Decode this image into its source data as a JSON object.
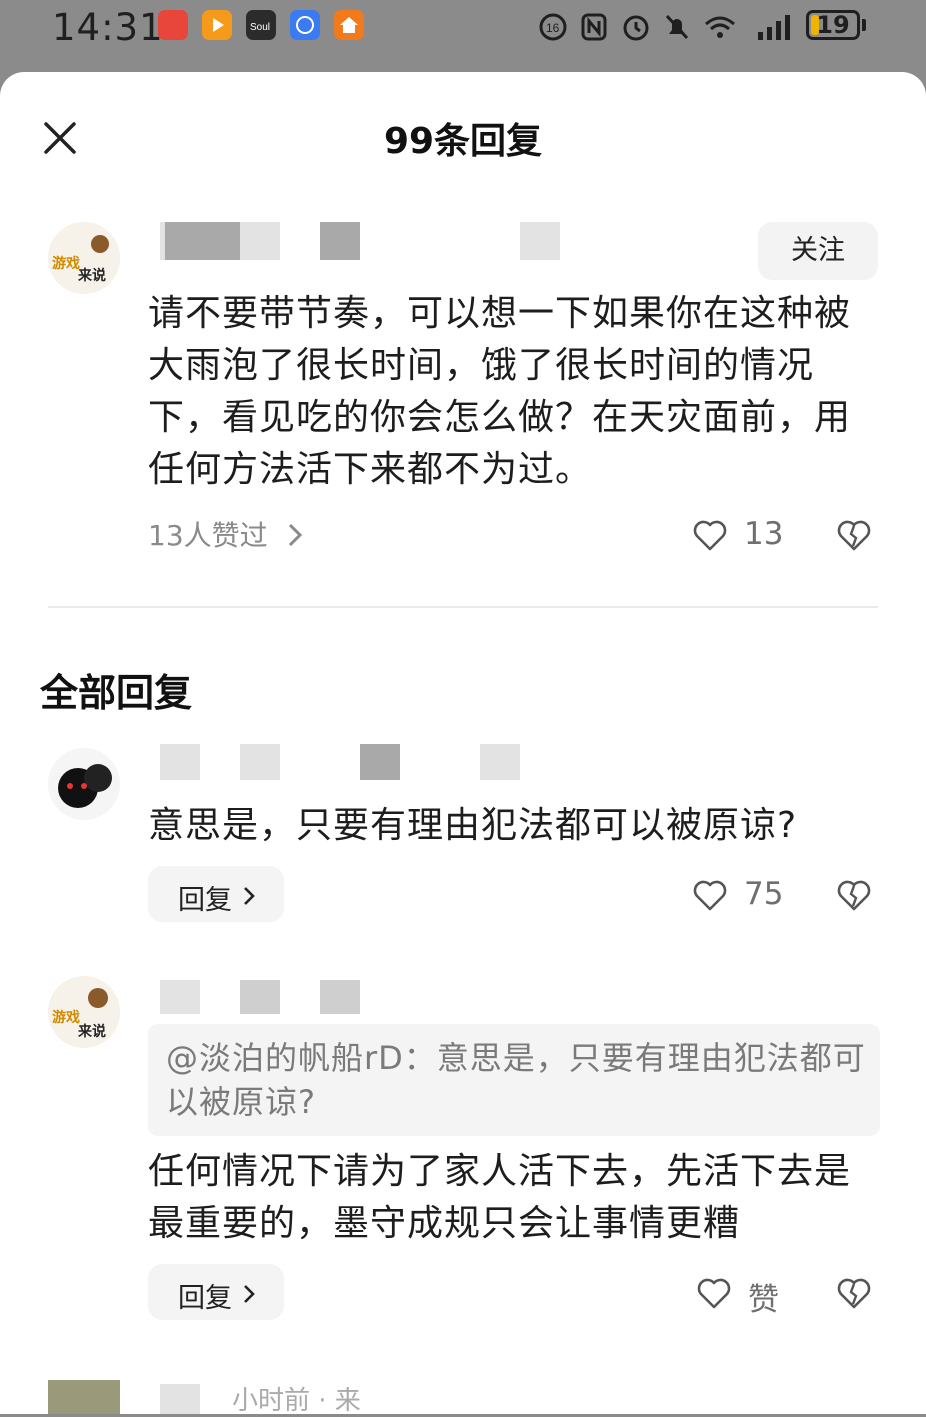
{
  "status_bar": {
    "time": "14:31",
    "battery": "19",
    "battery_fraction": 0.19
  },
  "sheet": {
    "title": "99条回复",
    "close_icon": "close-icon"
  },
  "main_comment": {
    "follow_label": "关注",
    "text": "请不要带节奏，可以想一下如果你在这种被大雨泡了很长时间，饿了很长时间的情况下，看见吃的你会怎么做？在天灾面前，用任何方法活下来都不为过。",
    "likers_text": "13人赞过",
    "like_count": "13"
  },
  "replies_section": {
    "title": "全部回复"
  },
  "replies": [
    {
      "text": "意思是，只要有理由犯法都可以被原谅?",
      "reply_label": "回复",
      "like_count": "75"
    },
    {
      "quote": "@淡泊的帆船rD：意思是，只要有理由犯法都可以被原谅?",
      "text": "任何情况下请为了家人活下去，先活下去是最重要的，墨守成规只会让事情更糟",
      "reply_label": "回复",
      "like_count": "赞"
    }
  ],
  "bottom_partial": {
    "text": "小时前 · 来"
  },
  "colors": {
    "background_dim": "#8b8b8b",
    "sheet": "#ffffff",
    "battery": "#f0b400"
  }
}
